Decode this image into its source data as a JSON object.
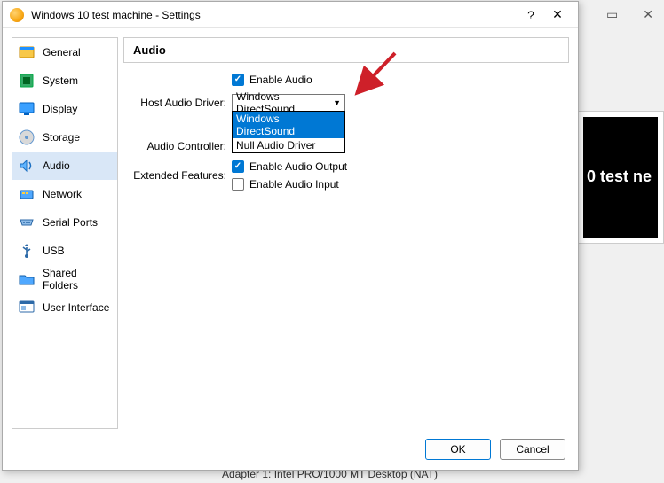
{
  "bg": {
    "thumb_text": "0 test\nne",
    "status": "Adapter 1:   Intel PRO/1000 MT Desktop (NAT)"
  },
  "window": {
    "title": "Windows 10 test machine - Settings",
    "help_glyph": "?",
    "close_glyph": "✕",
    "minimize_glyph": "▭"
  },
  "sidebar": {
    "items": [
      {
        "key": "general",
        "label": "General"
      },
      {
        "key": "system",
        "label": "System"
      },
      {
        "key": "display",
        "label": "Display"
      },
      {
        "key": "storage",
        "label": "Storage"
      },
      {
        "key": "audio",
        "label": "Audio",
        "selected": true
      },
      {
        "key": "network",
        "label": "Network"
      },
      {
        "key": "serial-ports",
        "label": "Serial Ports"
      },
      {
        "key": "usb",
        "label": "USB"
      },
      {
        "key": "shared-folders",
        "label": "Shared Folders"
      },
      {
        "key": "user-interface",
        "label": "User Interface"
      }
    ]
  },
  "panel": {
    "heading": "Audio",
    "enable_audio_label": "Enable Audio",
    "enable_audio_checked": true,
    "host_driver_label": "Host Audio Driver:",
    "host_driver_value": "Windows DirectSound",
    "host_driver_options": [
      {
        "label": "Windows DirectSound",
        "selected": true
      },
      {
        "label": "Null Audio Driver"
      }
    ],
    "audio_controller_label": "Audio Controller:",
    "extended_features_label": "Extended Features:",
    "enable_output_label": "Enable Audio Output",
    "enable_output_checked": true,
    "enable_input_label": "Enable Audio Input",
    "enable_input_checked": false
  },
  "footer": {
    "ok": "OK",
    "cancel": "Cancel"
  },
  "colors": {
    "accent": "#0078d4",
    "arrow": "#ce2029"
  }
}
